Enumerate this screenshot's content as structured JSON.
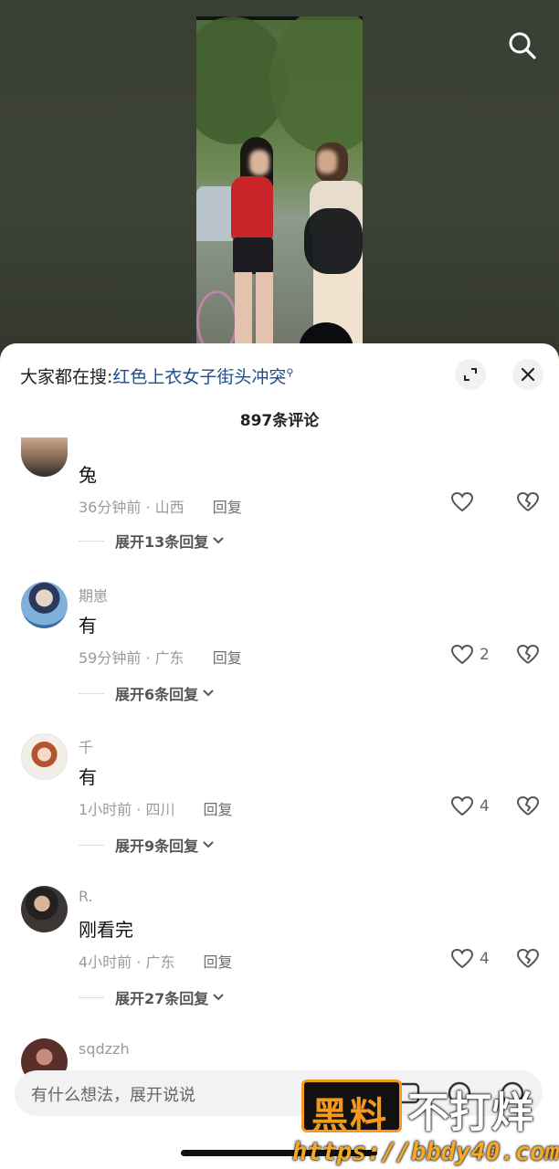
{
  "hot_search": {
    "prefix": "大家都在搜:",
    "query": "红色上衣女子街头冲突"
  },
  "comment_count": "897条评论",
  "comments": [
    {
      "username": "",
      "text": "兔",
      "time": "36分钟前 · 山西",
      "reply_label": "回复",
      "likes": "",
      "expand_label": "展开13条回复"
    },
    {
      "username": "期崽",
      "text": "有",
      "time": "59分钟前 · 广东",
      "reply_label": "回复",
      "likes": "2",
      "expand_label": "展开6条回复"
    },
    {
      "username": "千",
      "text": "有",
      "time": "1小时前 · 四川",
      "reply_label": "回复",
      "likes": "4",
      "expand_label": "展开9条回复"
    },
    {
      "username": "R.",
      "text": "刚看完",
      "time": "4小时前 · 广东",
      "reply_label": "回复",
      "likes": "4",
      "expand_label": "展开27条回复"
    },
    {
      "username": "sqdzzh",
      "text": "",
      "time": "",
      "reply_label": "",
      "likes": "",
      "expand_label": ""
    }
  ],
  "input": {
    "placeholder": "有什么想法，展开说说"
  },
  "watermark": {
    "badge": "黑料",
    "text": "不打烊",
    "url": "https://bbdy40.com"
  },
  "colors": {
    "link": "#1e4e88",
    "watermark_orange": "#f39a1c"
  }
}
